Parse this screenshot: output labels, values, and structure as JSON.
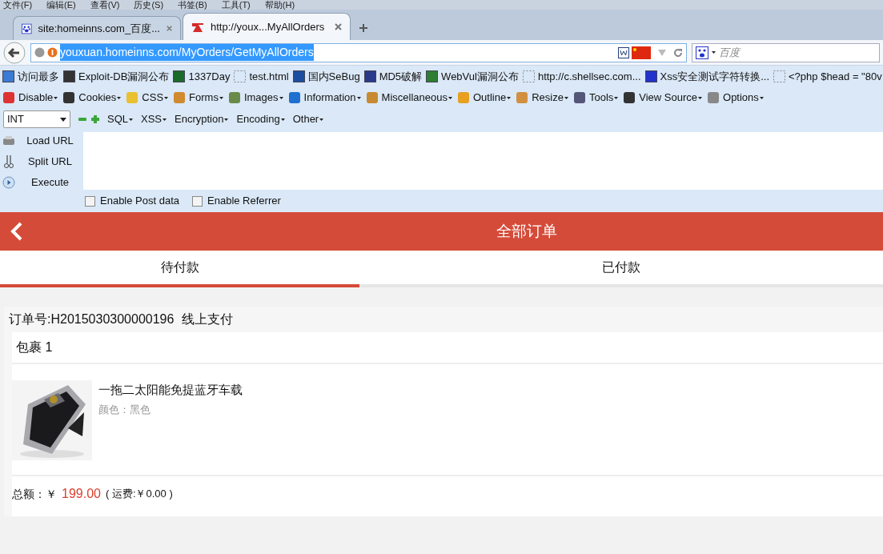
{
  "menu": [
    "文件(F)",
    "编辑(E)",
    "查看(V)",
    "历史(S)",
    "书签(B)",
    "工具(T)",
    "帮助(H)"
  ],
  "tabs": [
    {
      "title": "site:homeinns.com_百度...",
      "selected": false
    },
    {
      "title": "http://youx...MyAllOrders",
      "selected": true
    }
  ],
  "address": {
    "url": "youxuan.homeinns.com/MyOrders/GetMyAllOrders"
  },
  "search": {
    "placeholder": "百度"
  },
  "bookmarks": [
    "访问最多",
    "Exploit-DB漏洞公布",
    "1337Day",
    "test.html",
    "国内SeBug",
    "MD5破解",
    "WebVul漏洞公布",
    "http://c.shellsec.com...",
    "Xss安全测试字符转换...",
    "<?php $head = \"80v"
  ],
  "webdev_toolbar": [
    "Disable",
    "Cookies",
    "CSS",
    "Forms",
    "Images",
    "Information",
    "Miscellaneous",
    "Outline",
    "Resize",
    "Tools",
    "View Source",
    "Options"
  ],
  "hackbar": {
    "type_select": "INT",
    "menus": [
      "SQL",
      "XSS",
      "Encryption",
      "Encoding",
      "Other"
    ],
    "actions": [
      "Load URL",
      "Split URL",
      "Execute"
    ],
    "options": [
      {
        "label": "Enable Post data",
        "checked": false
      },
      {
        "label": "Enable Referrer",
        "checked": false
      }
    ]
  },
  "page": {
    "title": "全部订单",
    "tabs": [
      {
        "label": "待付款",
        "selected": true
      },
      {
        "label": "已付款",
        "selected": false
      }
    ],
    "order": {
      "number": "订单号:H2015030300000196",
      "payment": "线上支付",
      "package": "包裹 1",
      "item": {
        "name": "一拖二太阳能免提蓝牙车载",
        "variant": "颜色：黑色"
      },
      "total_label": "总额：￥",
      "total": "199.00",
      "shipping": "( 运费:￥0.00 )"
    }
  }
}
